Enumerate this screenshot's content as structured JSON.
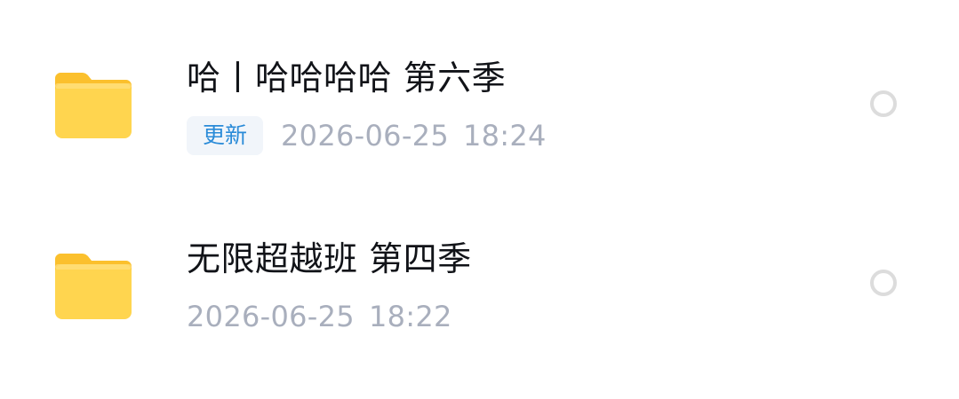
{
  "files": [
    {
      "icon": "folder-icon",
      "name": "哈丨哈哈哈哈 第六季",
      "badge": "更新",
      "date": "2026-06-25",
      "time": "18:24",
      "selected": false
    },
    {
      "icon": "folder-icon",
      "name": "无限超越班 第四季",
      "badge": "",
      "date": "2026-06-25",
      "time": "18:22",
      "selected": false
    }
  ],
  "colors": {
    "folder_body": "#FFD54F",
    "folder_tab": "#FBC02D",
    "title_text": "#111318",
    "date_text": "#A9AFBD",
    "badge_text": "#2A8BD8",
    "badge_bg": "#F1F5FA",
    "radio_border": "#DCDCDC"
  }
}
